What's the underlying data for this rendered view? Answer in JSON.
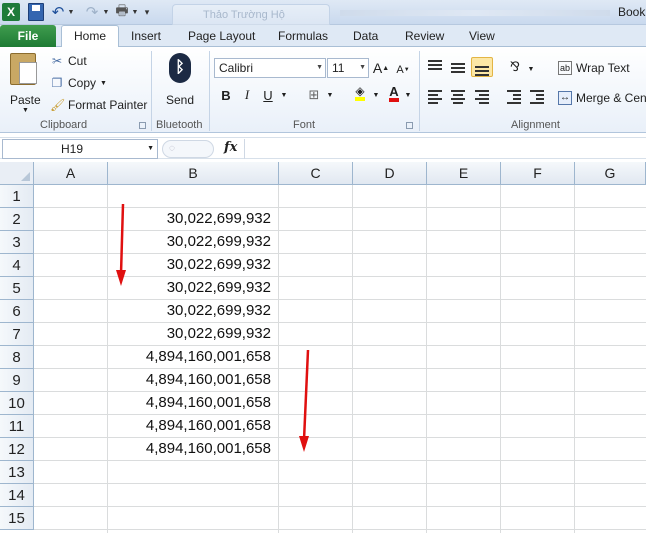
{
  "window": {
    "title": "Book"
  },
  "quick_access": {
    "app_icon": "X",
    "ghost_tab_text": "Thảo Trường Hộ"
  },
  "ribbon_tabs": [
    {
      "label": "File"
    },
    {
      "label": "Home"
    },
    {
      "label": "Insert"
    },
    {
      "label": "Page Layout"
    },
    {
      "label": "Formulas"
    },
    {
      "label": "Data"
    },
    {
      "label": "Review"
    },
    {
      "label": "View"
    }
  ],
  "clipboard": {
    "paste": "Paste",
    "cut": "Cut",
    "copy": "Copy",
    "format_painter": "Format Painter",
    "group_label": "Clipboard"
  },
  "bluetooth": {
    "send": "Send",
    "group_label": "Bluetooth"
  },
  "font": {
    "name": "Calibri",
    "size": "11",
    "group_label": "Font",
    "bold": "B",
    "italic": "I",
    "underline": "U",
    "grow": "A",
    "shrink": "A",
    "font_color": "A"
  },
  "alignment": {
    "wrap_text": "Wrap Text",
    "merge_center": "Merge & Cen",
    "group_label": "Alignment"
  },
  "formula_bar": {
    "name_box": "H19",
    "fx": "fx",
    "value": ""
  },
  "columns": [
    "A",
    "B",
    "C",
    "D",
    "E",
    "F",
    "G"
  ],
  "rows": [
    "1",
    "2",
    "3",
    "4",
    "5",
    "6",
    "7",
    "8",
    "9",
    "10",
    "11",
    "12",
    "13",
    "14",
    "15"
  ],
  "cells_b": [
    "",
    "30,022,699,932",
    "30,022,699,932",
    "30,022,699,932",
    "30,022,699,932",
    "30,022,699,932",
    "30,022,699,932",
    "4,894,160,001,658",
    "4,894,160,001,658",
    "4,894,160,001,658",
    "4,894,160,001,658",
    "4,894,160,001,658",
    "",
    "",
    ""
  ],
  "colors": {
    "file_tab": "#2a8a3e",
    "arrow": "#e01010",
    "grid_line": "#dadcdd",
    "header_border": "#9eb6ce"
  }
}
